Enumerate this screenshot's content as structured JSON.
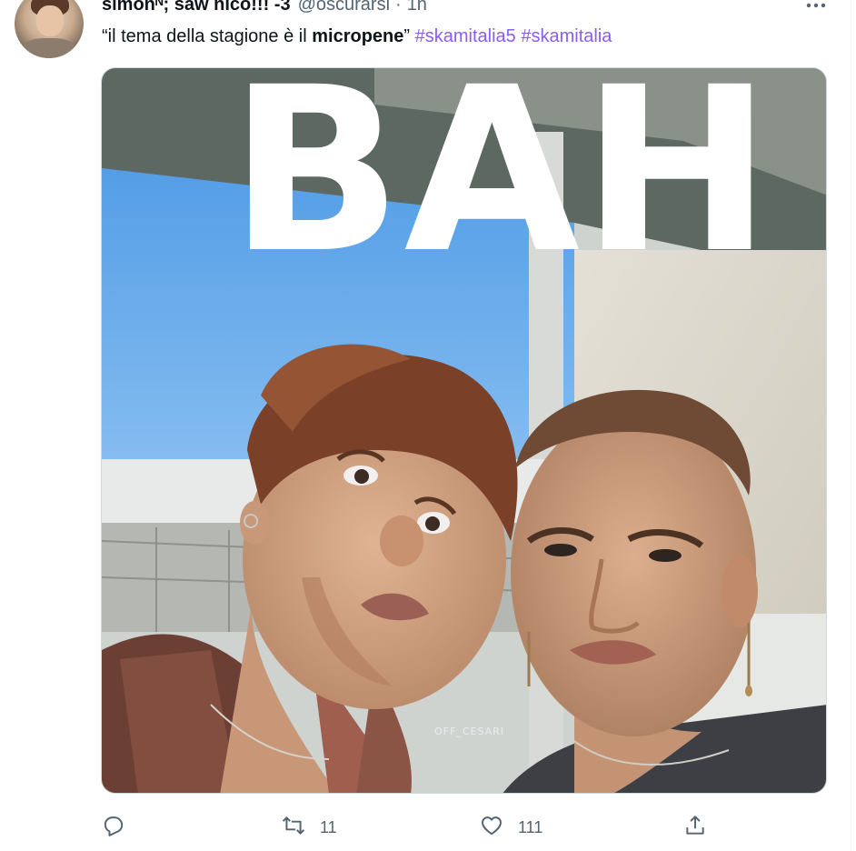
{
  "author": {
    "display_name": "simonᴺ; saw nico!!! -3",
    "handle": "@oscurarsi",
    "separator": "·",
    "time": "1h"
  },
  "tweet": {
    "text_open_quote": "“il tema della stagione è il ",
    "text_bold": "micropene",
    "text_close_quote": "”",
    "hashtags": [
      "#skamitalia5",
      "#skamitalia"
    ]
  },
  "media": {
    "caption": "BAH",
    "watermark": "OFF_CESARI"
  },
  "actions": {
    "reply": {
      "icon": "reply-icon",
      "count": ""
    },
    "retweet": {
      "icon": "retweet-icon",
      "count": "11"
    },
    "like": {
      "icon": "heart-icon",
      "count": "111"
    },
    "share": {
      "icon": "share-icon",
      "count": ""
    }
  },
  "colors": {
    "hashtag": "#8b5cf6",
    "secondary_text": "#536471",
    "primary_text": "#0f1419"
  }
}
